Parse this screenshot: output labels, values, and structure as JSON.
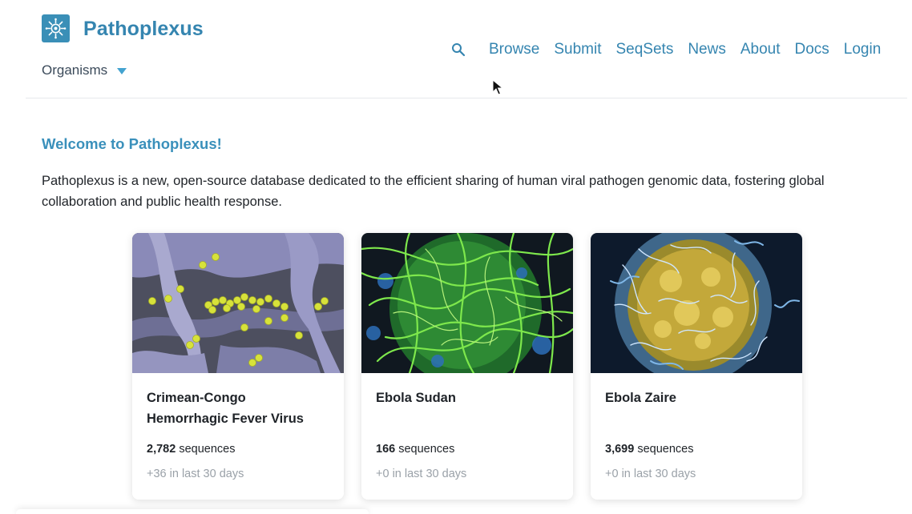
{
  "header": {
    "site_title": "Pathoplexus",
    "organisms_label": "Organisms",
    "nav": [
      {
        "label": "Browse"
      },
      {
        "label": "Submit"
      },
      {
        "label": "SeqSets"
      },
      {
        "label": "News"
      },
      {
        "label": "About"
      },
      {
        "label": "Docs"
      },
      {
        "label": "Login"
      }
    ],
    "icons": {
      "logo": "pathoplexus-logo-icon",
      "search": "search-icon",
      "dropdown": "caret-down-icon"
    }
  },
  "main": {
    "welcome_title": "Welcome to Pathoplexus!",
    "intro_text": "Pathoplexus is a new, open-source database dedicated to the efficient sharing of human viral pathogen genomic data, fostering global collaboration and public health response.",
    "sequences_suffix": " sequences",
    "cards": [
      {
        "name": "Crimean-Congo Hemorrhagic Fever Virus",
        "count": "2,782",
        "recent_count": "+36",
        "recent_suffix": " in last 30 days"
      },
      {
        "name": "Ebola Sudan",
        "count": "166",
        "recent_count": "+0",
        "recent_suffix": " in last 30 days"
      },
      {
        "name": "Ebola Zaire",
        "count": "3,699",
        "recent_count": "+0",
        "recent_suffix": " in last 30 days"
      }
    ]
  },
  "colors": {
    "brand": "#3585b0",
    "heading": "#3a90bb",
    "caret": "#43a3d0",
    "muted": "#9aa1a8"
  }
}
